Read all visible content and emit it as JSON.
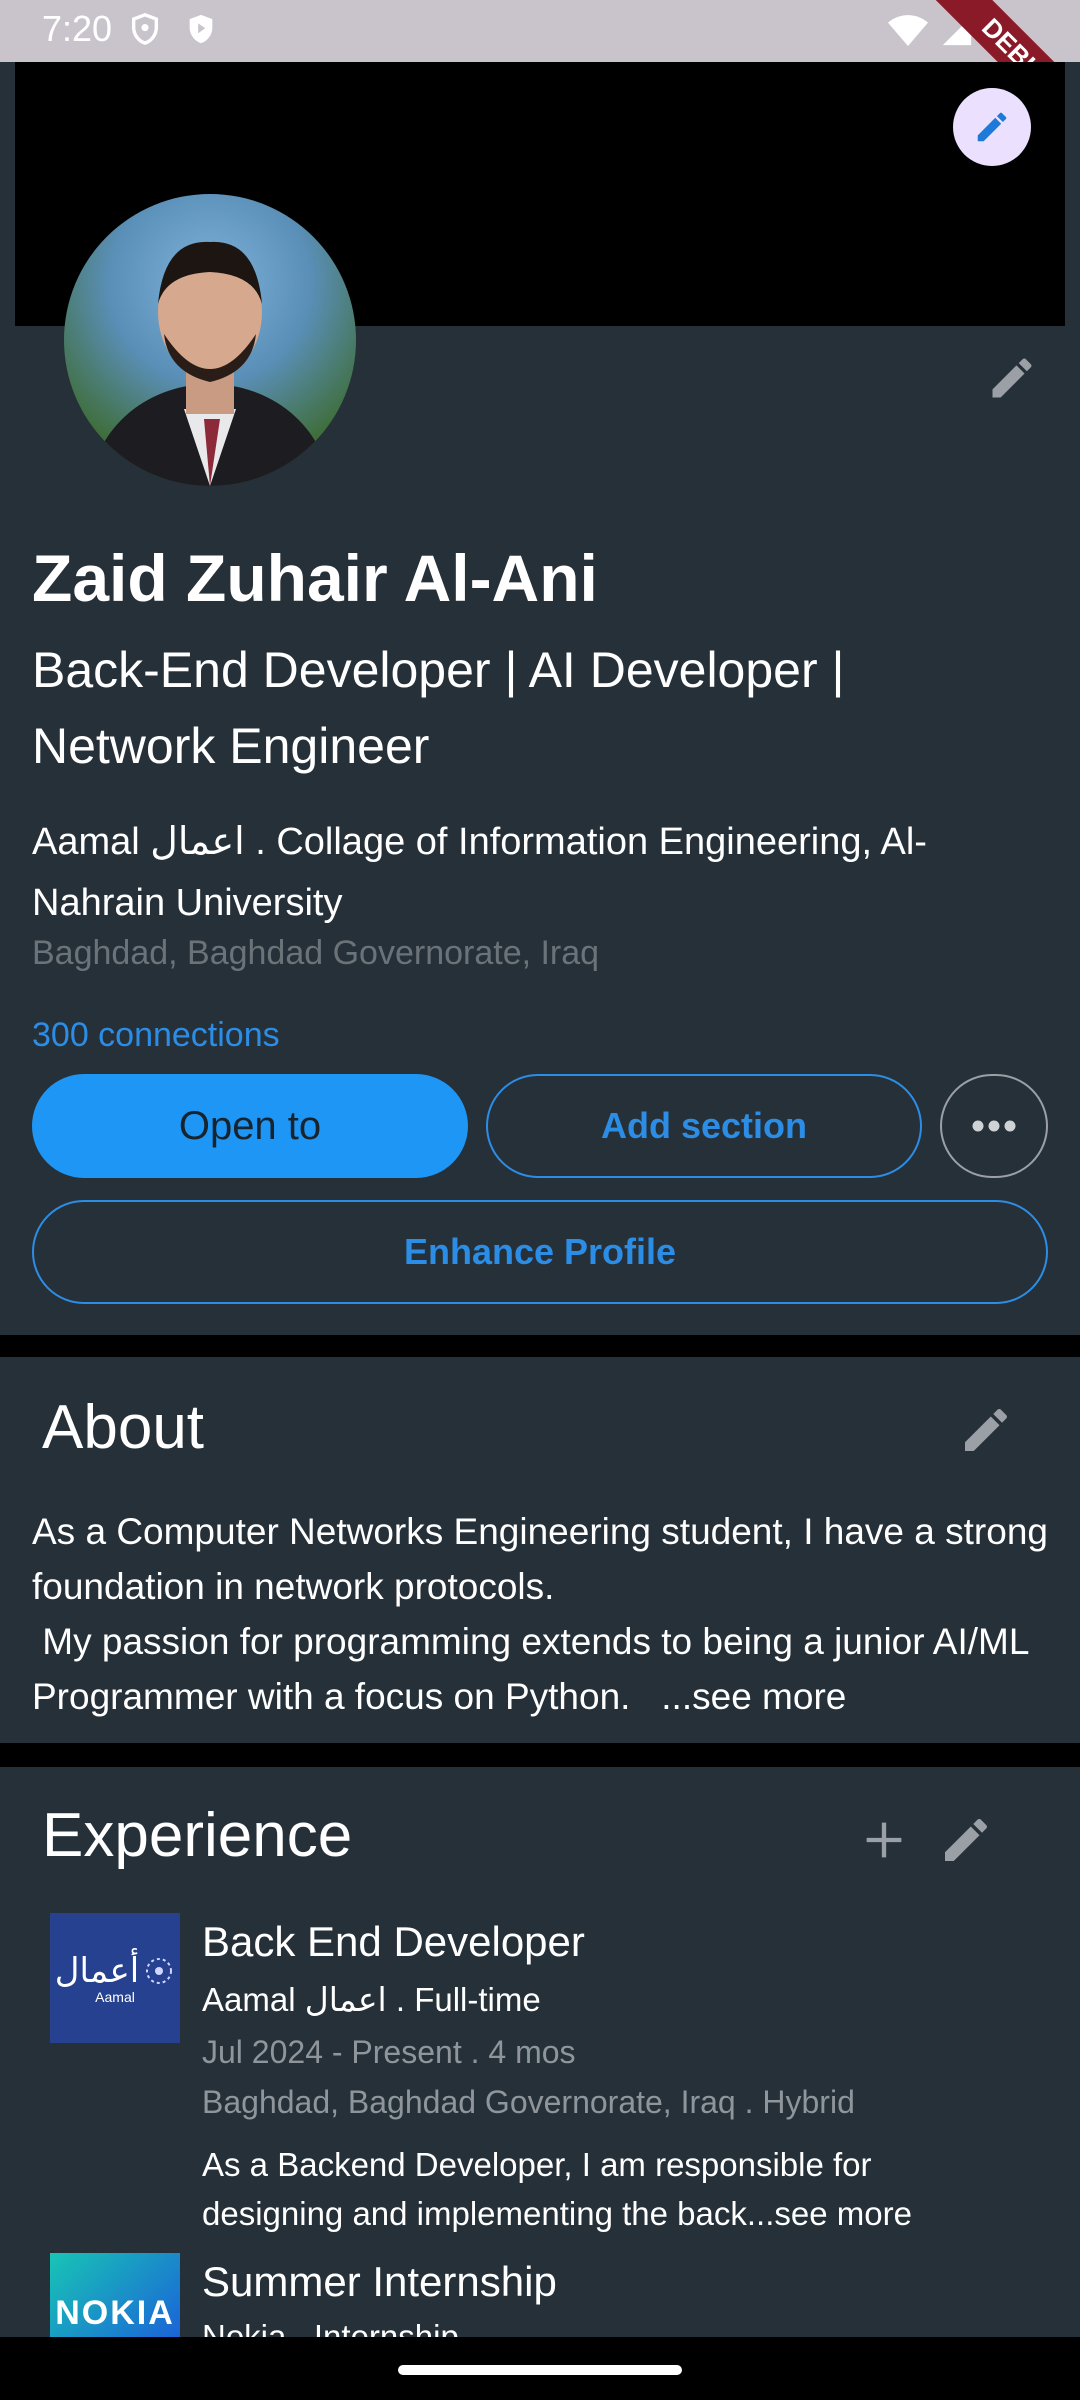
{
  "status_bar": {
    "time": "7:20",
    "icons": [
      "shield-icon",
      "play-protect-icon",
      "wifi-icon",
      "signal-icon",
      "battery-icon"
    ]
  },
  "debug_ribbon": "DEBUG",
  "profile": {
    "name": "Zaid Zuhair Al-Ani",
    "headline": "Back-End Developer | AI Developer | Network Engineer",
    "organization": "Aamal اعمال . Collage of Information Engineering, Al-Nahrain University",
    "location": "Baghdad, Baghdad Governorate, Iraq",
    "connections": "300 connections",
    "buttons": {
      "open_to": "Open to",
      "add_section": "Add section",
      "enhance": "Enhance Profile"
    }
  },
  "about": {
    "title": "About",
    "text": "As a Computer Networks Engineering student, I have a strong foundation in network protocols.\n My passion for programming extends to being a junior AI/ML Programmer with a focus on Python.   ...see more"
  },
  "experience": {
    "title": "Experience",
    "items": [
      {
        "logo_text": "أعمال",
        "logo_subtext": "Aamal",
        "title": "Back End Developer",
        "company": "Aamal اعمال . Full-time",
        "dates": "Jul 2024 - Present . 4 mos",
        "location": "Baghdad, Baghdad Governorate, Iraq . Hybrid",
        "description": "As a Backend Developer, I am responsible for designing and implementing the back...see more"
      },
      {
        "logo_text": "NOKIA",
        "title": "Summer Internship",
        "company": "Nokia . Internship"
      }
    ]
  },
  "colors": {
    "accent": "#1e96f5",
    "card_bg": "#263038",
    "link": "#2c8de6"
  }
}
